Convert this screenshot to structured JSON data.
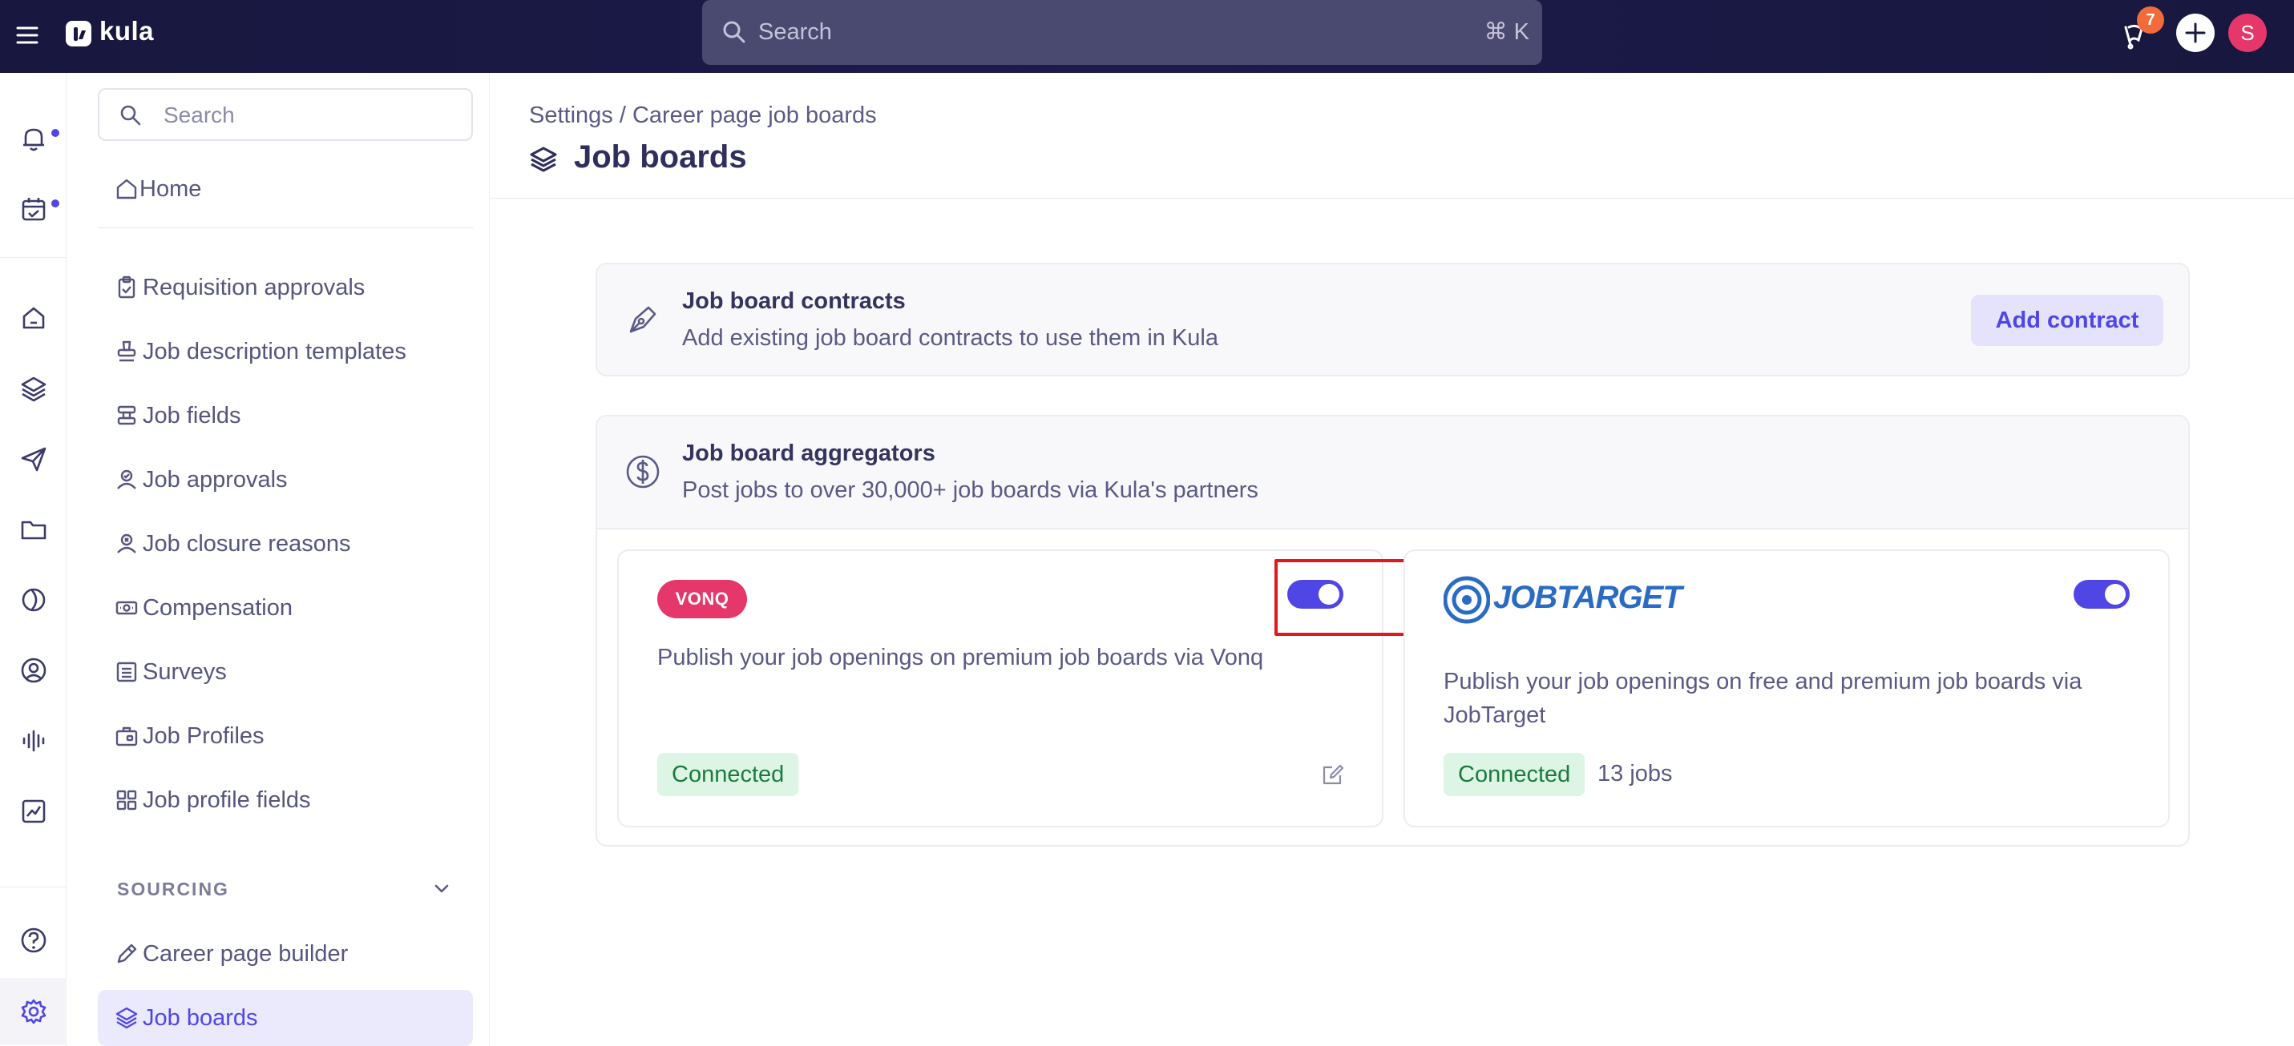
{
  "app": {
    "name": "kula",
    "brand_color": "#4f46e5",
    "topbar_color": "#17173f"
  },
  "topbar": {
    "search_placeholder": "Search",
    "shortcut": "⌘ K",
    "notification_count": "7",
    "avatar_initial": "S"
  },
  "rail": {
    "icons": [
      "bell-icon",
      "calendar-check-icon",
      "home-icon",
      "layers-icon",
      "send-icon",
      "folder-icon",
      "half-circle-icon",
      "user-circle-icon",
      "audio-wave-icon",
      "chart-icon",
      "help-icon",
      "gear-icon"
    ]
  },
  "sidebar": {
    "search_placeholder": "Search",
    "home": "Home",
    "items": [
      {
        "label": "Requisition approvals",
        "icon": "clipboard-check-icon"
      },
      {
        "label": "Job description templates",
        "icon": "stamp-icon"
      },
      {
        "label": "Job fields",
        "icon": "stamp-icon"
      },
      {
        "label": "Job approvals",
        "icon": "user-check-icon"
      },
      {
        "label": "Job closure reasons",
        "icon": "user-x-icon"
      },
      {
        "label": "Compensation",
        "icon": "money-icon"
      },
      {
        "label": "Surveys",
        "icon": "list-icon"
      },
      {
        "label": "Job Profiles",
        "icon": "briefcase-icon"
      },
      {
        "label": "Job profile fields",
        "icon": "grid-icon"
      }
    ],
    "section_label": "SOURCING",
    "sourcing_items": [
      {
        "label": "Career page builder",
        "icon": "pen-icon"
      },
      {
        "label": "Job boards",
        "icon": "layers-icon",
        "active": true
      }
    ]
  },
  "main": {
    "breadcrumb": "Settings / Career page job boards",
    "title": "Job boards",
    "contracts": {
      "title": "Job board contracts",
      "subtitle": "Add existing job board contracts to use them in Kula",
      "button": "Add contract"
    },
    "aggregators": {
      "title": "Job board aggregators",
      "subtitle": "Post jobs to over 30,000+ job boards via Kula's partners",
      "providers": [
        {
          "name": "VONQ",
          "description": "Publish your job openings on premium job boards via Vonq",
          "status": "Connected",
          "enabled": true
        },
        {
          "name": "JOBTARGET",
          "description": "Publish your job openings on free and premium job boards via JobTarget",
          "status": "Connected",
          "jobs": "13 jobs",
          "enabled": true
        }
      ]
    }
  }
}
